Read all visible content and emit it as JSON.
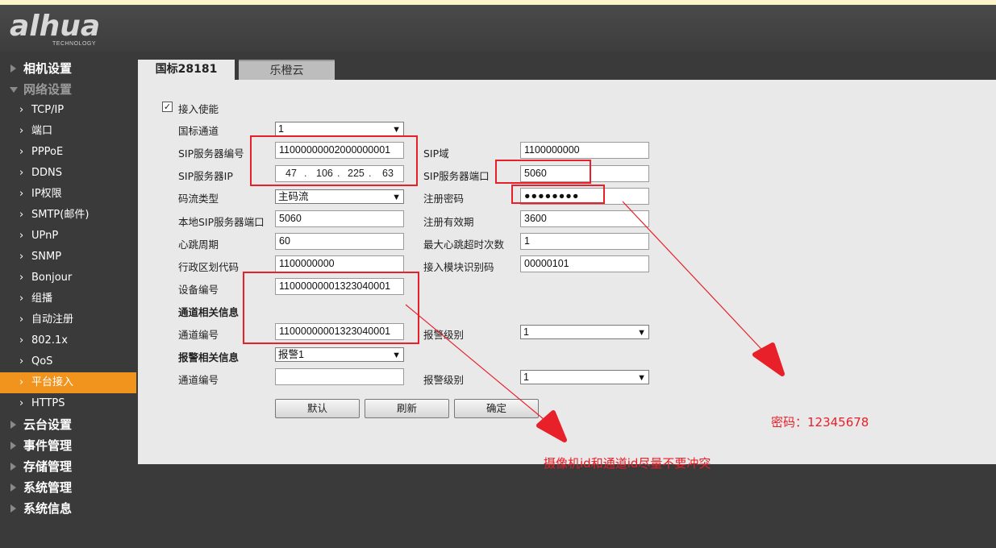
{
  "brand": {
    "logo_text": "alhua",
    "logo_sub": "TECHNOLOGY"
  },
  "sidebar": {
    "items": [
      {
        "label": "相机设置",
        "level": "top",
        "state": "collapsed"
      },
      {
        "label": "网络设置",
        "level": "top",
        "state": "expanded"
      },
      {
        "label": "TCP/IP",
        "level": "sub"
      },
      {
        "label": "端口",
        "level": "sub"
      },
      {
        "label": "PPPoE",
        "level": "sub"
      },
      {
        "label": "DDNS",
        "level": "sub"
      },
      {
        "label": "IP权限",
        "level": "sub"
      },
      {
        "label": "SMTP(邮件)",
        "level": "sub"
      },
      {
        "label": "UPnP",
        "level": "sub"
      },
      {
        "label": "SNMP",
        "level": "sub"
      },
      {
        "label": "Bonjour",
        "level": "sub"
      },
      {
        "label": "组播",
        "level": "sub"
      },
      {
        "label": "自动注册",
        "level": "sub"
      },
      {
        "label": "802.1x",
        "level": "sub"
      },
      {
        "label": "QoS",
        "level": "sub"
      },
      {
        "label": "平台接入",
        "level": "sub",
        "state": "active"
      },
      {
        "label": "HTTPS",
        "level": "sub"
      },
      {
        "label": "云台设置",
        "level": "top",
        "state": "collapsed"
      },
      {
        "label": "事件管理",
        "level": "top",
        "state": "collapsed"
      },
      {
        "label": "存储管理",
        "level": "top",
        "state": "collapsed"
      },
      {
        "label": "系统管理",
        "level": "top",
        "state": "collapsed"
      },
      {
        "label": "系统信息",
        "level": "top",
        "state": "collapsed"
      }
    ]
  },
  "tabs": [
    {
      "label": "国标28181",
      "active": true
    },
    {
      "label": "乐橙云",
      "active": false
    }
  ],
  "form": {
    "enable": {
      "label": "接入使能",
      "checked": true,
      "check_glyph": "✓"
    },
    "gb_channel": {
      "label": "国标通道",
      "value": "1"
    },
    "sip_server_id": {
      "label": "SIP服务器编号",
      "value": "11000000002000000001"
    },
    "sip_domain": {
      "label": "SIP域",
      "value": "1100000000"
    },
    "sip_server_ip": {
      "label": "SIP服务器IP",
      "octets": [
        "47",
        "106",
        "225",
        "63"
      ]
    },
    "sip_server_port": {
      "label": "SIP服务器端口",
      "value": "5060"
    },
    "stream_type": {
      "label": "码流类型",
      "value": "主码流"
    },
    "reg_password": {
      "label": "注册密码",
      "value": "●●●●●●●●"
    },
    "local_sip_port": {
      "label": "本地SIP服务器端口",
      "value": "5060"
    },
    "reg_validity": {
      "label": "注册有效期",
      "value": "3600"
    },
    "heartbeat_period": {
      "label": "心跳周期",
      "value": "60"
    },
    "max_heartbeat_timeout": {
      "label": "最大心跳超时次数",
      "value": "1"
    },
    "region_code": {
      "label": "行政区划代码",
      "value": "1100000000"
    },
    "module_id": {
      "label": "接入模块识别码",
      "value": "00000101"
    },
    "device_id": {
      "label": "设备编号",
      "value": "11000000001323040001"
    },
    "channel_section": {
      "label": "通道相关信息"
    },
    "channel_id": {
      "label": "通道编号",
      "value": "11000000001323040001"
    },
    "channel_alarm_level": {
      "label": "报警级别",
      "value": "1"
    },
    "alarm_section": {
      "label": "报警相关信息",
      "select_value": "报警1"
    },
    "alarm_channel_id": {
      "label": "通道编号",
      "value": ""
    },
    "alarm_level": {
      "label": "报警级别",
      "value": "1"
    }
  },
  "buttons": {
    "default": "默认",
    "refresh": "刷新",
    "confirm": "确定"
  },
  "annotations": {
    "password_note": "密码：12345678",
    "id_note": "摄像机id和通道id尽量不要冲突",
    "color": "#e8202a"
  }
}
